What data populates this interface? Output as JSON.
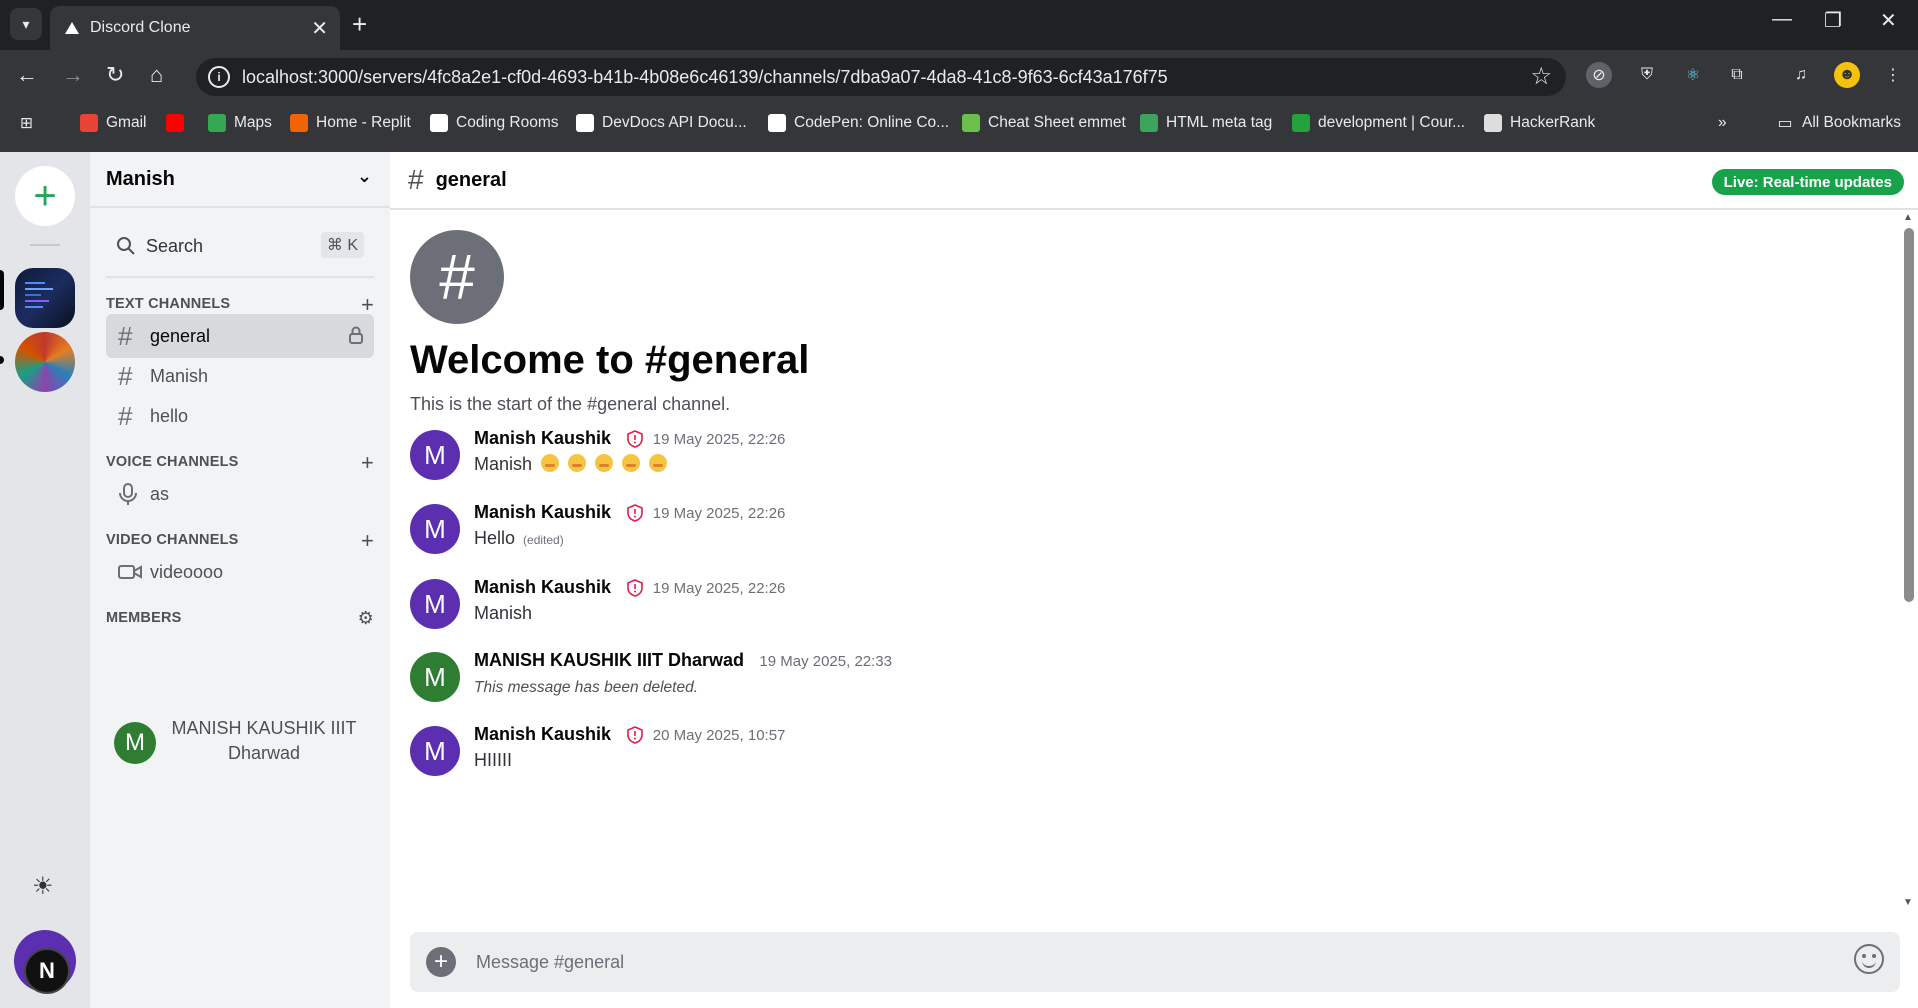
{
  "browser": {
    "tab_title": "Discord Clone",
    "url": "localhost:3000/servers/4fc8a2e1-cf0d-4693-b41b-4b08e6c46139/channels/7dba9a07-4da8-41c8-9f63-6cf43a176f75",
    "bookmarks": [
      {
        "label": "Gmail",
        "icon": "gmail-icon",
        "color": "#ea4335"
      },
      {
        "label": "",
        "icon": "youtube-icon",
        "color": "#ff0000"
      },
      {
        "label": "Maps",
        "icon": "maps-icon",
        "color": "#34a853"
      },
      {
        "label": "Home - Replit",
        "icon": "replit-icon",
        "color": "#f26207"
      },
      {
        "label": "Coding Rooms",
        "icon": "coding-rooms-icon",
        "color": "#ffffff"
      },
      {
        "label": "DevDocs API Docu...",
        "icon": "devdocs-icon",
        "color": "#ffffff"
      },
      {
        "label": "CodePen: Online Co...",
        "icon": "codepen-icon",
        "color": "#ffffff"
      },
      {
        "label": "Cheat Sheet emmet",
        "icon": "emmet-icon",
        "color": "#6bc04b"
      },
      {
        "label": "HTML meta tag",
        "icon": "w-icon",
        "color": "#3ba55d"
      },
      {
        "label": "development | Cour...",
        "icon": "check-icon",
        "color": "#22a33b"
      },
      {
        "label": "HackerRank",
        "icon": "hackerrank-icon",
        "color": "#dddddd"
      }
    ],
    "all_bookmarks": "All Bookmarks"
  },
  "server": {
    "name": "Manish",
    "search_label": "Search",
    "search_shortcut": "⌘ K"
  },
  "sections": {
    "text": "TEXT CHANNELS",
    "voice": "VOICE CHANNELS",
    "video": "VIDEO CHANNELS",
    "members": "MEMBERS"
  },
  "text_channels": [
    {
      "name": "general",
      "active": true,
      "locked": true
    },
    {
      "name": "Manish",
      "active": false
    },
    {
      "name": "hello",
      "active": false
    }
  ],
  "voice_channels": [
    {
      "name": "as"
    }
  ],
  "video_channels": [
    {
      "name": "videoooo"
    }
  ],
  "members": [
    {
      "initial": "M",
      "name": "MANISH KAUSHIK IIIT Dharwad"
    }
  ],
  "channel": {
    "name": "general",
    "live_badge": "Live: Real-time updates",
    "welcome_title": "Welcome to #general",
    "welcome_sub": "This is the start of the #general channel.",
    "composer_placeholder": "Message #general"
  },
  "messages": [
    {
      "initial": "M",
      "author": "Manish Kaushik",
      "admin": true,
      "time": "19 May 2025, 22:26",
      "text": "Manish",
      "emoji_count": 5,
      "edited": "",
      "deleted": false,
      "avatar_color": "#5b2fb0"
    },
    {
      "initial": "M",
      "author": "Manish Kaushik",
      "admin": true,
      "time": "19 May 2025, 22:26",
      "text": "Hello",
      "emoji_count": 0,
      "edited": "(edited)",
      "deleted": false,
      "avatar_color": "#5b2fb0"
    },
    {
      "initial": "M",
      "author": "Manish Kaushik",
      "admin": true,
      "time": "19 May 2025, 22:26",
      "text": "Manish",
      "emoji_count": 0,
      "edited": "",
      "deleted": false,
      "avatar_color": "#5b2fb0"
    },
    {
      "initial": "M",
      "author": "MANISH KAUSHIK IIIT Dharwad",
      "admin": false,
      "time": "19 May 2025, 22:33",
      "text": "This message has been deleted.",
      "emoji_count": 0,
      "edited": "",
      "deleted": true,
      "avatar_color": "#2e7d32"
    },
    {
      "initial": "M",
      "author": "Manish Kaushik",
      "admin": true,
      "time": "20 May 2025, 10:57",
      "text": "HIIIII",
      "emoji_count": 0,
      "edited": "",
      "deleted": false,
      "avatar_color": "#5b2fb0"
    }
  ],
  "user_badge": "N"
}
